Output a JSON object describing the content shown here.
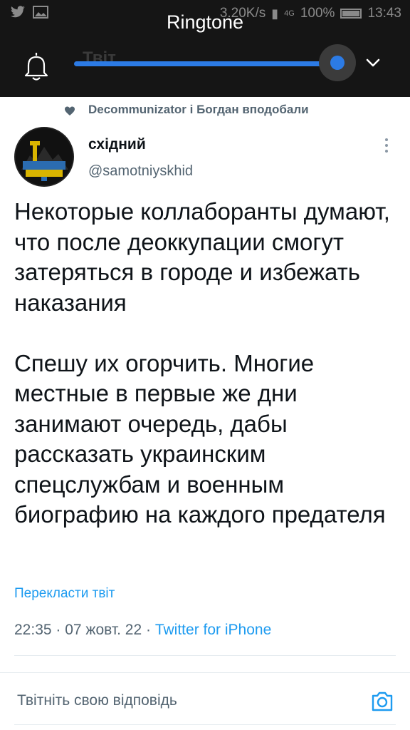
{
  "status_bar": {
    "network_speed": "3.20K/s",
    "signal_label": "4G",
    "battery": "100%",
    "time": "13:43",
    "left_icons": [
      "twitter-icon",
      "gallery-icon"
    ]
  },
  "volume_panel": {
    "title": "Ringtone",
    "level": 0.98,
    "faded_header": "Твіт"
  },
  "tweet": {
    "social_context": "Decommunizator і Богдан вподобали",
    "author_name": "східний",
    "author_handle": "@samotniyskhid",
    "text": "Некоторые коллаборанты думают, что после деоккупации смогут затеряться в городе и избежать наказания\n\nСпешу их огорчить. Многие местные в первые же дни занимают очередь, дабы рассказать украинским спецслужбам и военным биографию на каждого предателя",
    "translate_label": "Перекласти твіт",
    "time": "22:35",
    "date": "07 жовт. 22",
    "source": "Twitter for iPhone",
    "separator": " · "
  },
  "reply": {
    "placeholder": "Твітніть свою відповідь"
  },
  "colors": {
    "accent": "#1d9bf0",
    "slider": "#2c7be5",
    "overlay_bg": "#151515",
    "text": "#0f1419",
    "muted": "#536471"
  }
}
